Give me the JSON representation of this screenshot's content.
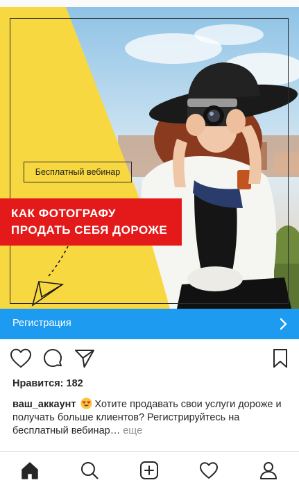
{
  "post": {
    "badge_text": "Бесплатный вебинар",
    "headline_line1": "КАК ФОТОГРАФУ",
    "headline_line2": "ПРОДАТЬ СЕБЯ ДОРОЖЕ",
    "cta_label": "Регистрация",
    "likes_label": "Нравится: 182",
    "username": "ваш_аккаунт",
    "caption_text": "Хотите продавать свои услуги дороже и получать больше клиентов? Регистрируйтесь на бесплатный вебинар…",
    "more_label": "еще"
  },
  "icons": {
    "actions": [
      "heart-icon",
      "comment-icon",
      "share-icon",
      "bookmark-icon"
    ],
    "nav": [
      "home-icon",
      "search-icon",
      "add-post-icon",
      "activity-heart-icon",
      "profile-icon"
    ],
    "emoji": "heart-eyes-emoji"
  },
  "colors": {
    "accent_yellow": "#f8d840",
    "headline_red": "#e41a1a",
    "cta_blue": "#1d9bf0",
    "more_gray": "#8e8e8e"
  }
}
